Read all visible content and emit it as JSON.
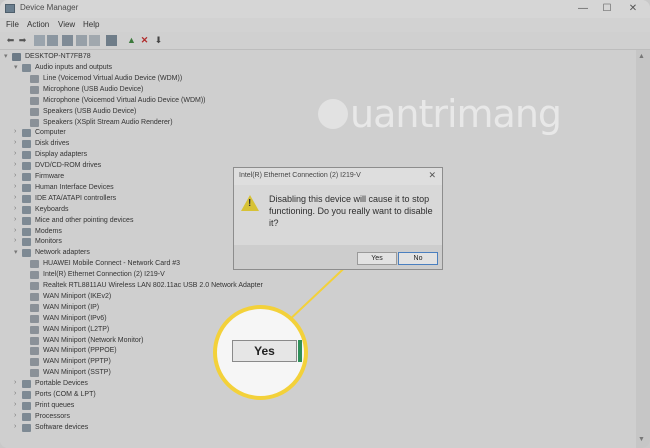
{
  "window": {
    "title": "Device Manager",
    "minimize": "—",
    "maximize": "☐",
    "close": "✕"
  },
  "menu": [
    "File",
    "Action",
    "View",
    "Help"
  ],
  "tree": {
    "root": "DESKTOP-NT7FB78",
    "nodes": [
      {
        "label": "Audio inputs and outputs",
        "expanded": true,
        "level": 1
      },
      {
        "label": "Line (Voicemod Virtual Audio Device (WDM))",
        "level": 2
      },
      {
        "label": "Microphone (USB Audio Device)",
        "level": 2
      },
      {
        "label": "Microphone (Voicemod Virtual Audio Device (WDM))",
        "level": 2
      },
      {
        "label": "Speakers (USB Audio Device)",
        "level": 2
      },
      {
        "label": "Speakers (XSplit Stream Audio Renderer)",
        "level": 2
      },
      {
        "label": "Computer",
        "level": 1
      },
      {
        "label": "Disk drives",
        "level": 1
      },
      {
        "label": "Display adapters",
        "level": 1
      },
      {
        "label": "DVD/CD-ROM drives",
        "level": 1
      },
      {
        "label": "Firmware",
        "level": 1
      },
      {
        "label": "Human Interface Devices",
        "level": 1
      },
      {
        "label": "IDE ATA/ATAPI controllers",
        "level": 1
      },
      {
        "label": "Keyboards",
        "level": 1
      },
      {
        "label": "Mice and other pointing devices",
        "level": 1
      },
      {
        "label": "Modems",
        "level": 1
      },
      {
        "label": "Monitors",
        "level": 1
      },
      {
        "label": "Network adapters",
        "expanded": true,
        "level": 1
      },
      {
        "label": "HUAWEI Mobile Connect - Network Card #3",
        "level": 2
      },
      {
        "label": "Intel(R) Ethernet Connection (2) I219-V",
        "level": 2
      },
      {
        "label": "Realtek RTL8811AU Wireless LAN 802.11ac USB 2.0 Network Adapter",
        "level": 2
      },
      {
        "label": "WAN Miniport (IKEv2)",
        "level": 2
      },
      {
        "label": "WAN Miniport (IP)",
        "level": 2
      },
      {
        "label": "WAN Miniport (IPv6)",
        "level": 2
      },
      {
        "label": "WAN Miniport (L2TP)",
        "level": 2
      },
      {
        "label": "WAN Miniport (Network Monitor)",
        "level": 2
      },
      {
        "label": "WAN Miniport (PPPOE)",
        "level": 2
      },
      {
        "label": "WAN Miniport (PPTP)",
        "level": 2
      },
      {
        "label": "WAN Miniport (SSTP)",
        "level": 2
      },
      {
        "label": "Portable Devices",
        "level": 1
      },
      {
        "label": "Ports (COM & LPT)",
        "level": 1
      },
      {
        "label": "Print queues",
        "level": 1
      },
      {
        "label": "Processors",
        "level": 1
      },
      {
        "label": "Software devices",
        "level": 1
      }
    ]
  },
  "watermark": "uantrimang",
  "dialog": {
    "title": "Intel(R) Ethernet Connection (2) I219-V",
    "message": "Disabling this device will cause it to stop functioning. Do you really want to disable it?",
    "yes": "Yes",
    "no": "No"
  },
  "callout": {
    "label": "Yes",
    "color": "#f3d13a"
  }
}
